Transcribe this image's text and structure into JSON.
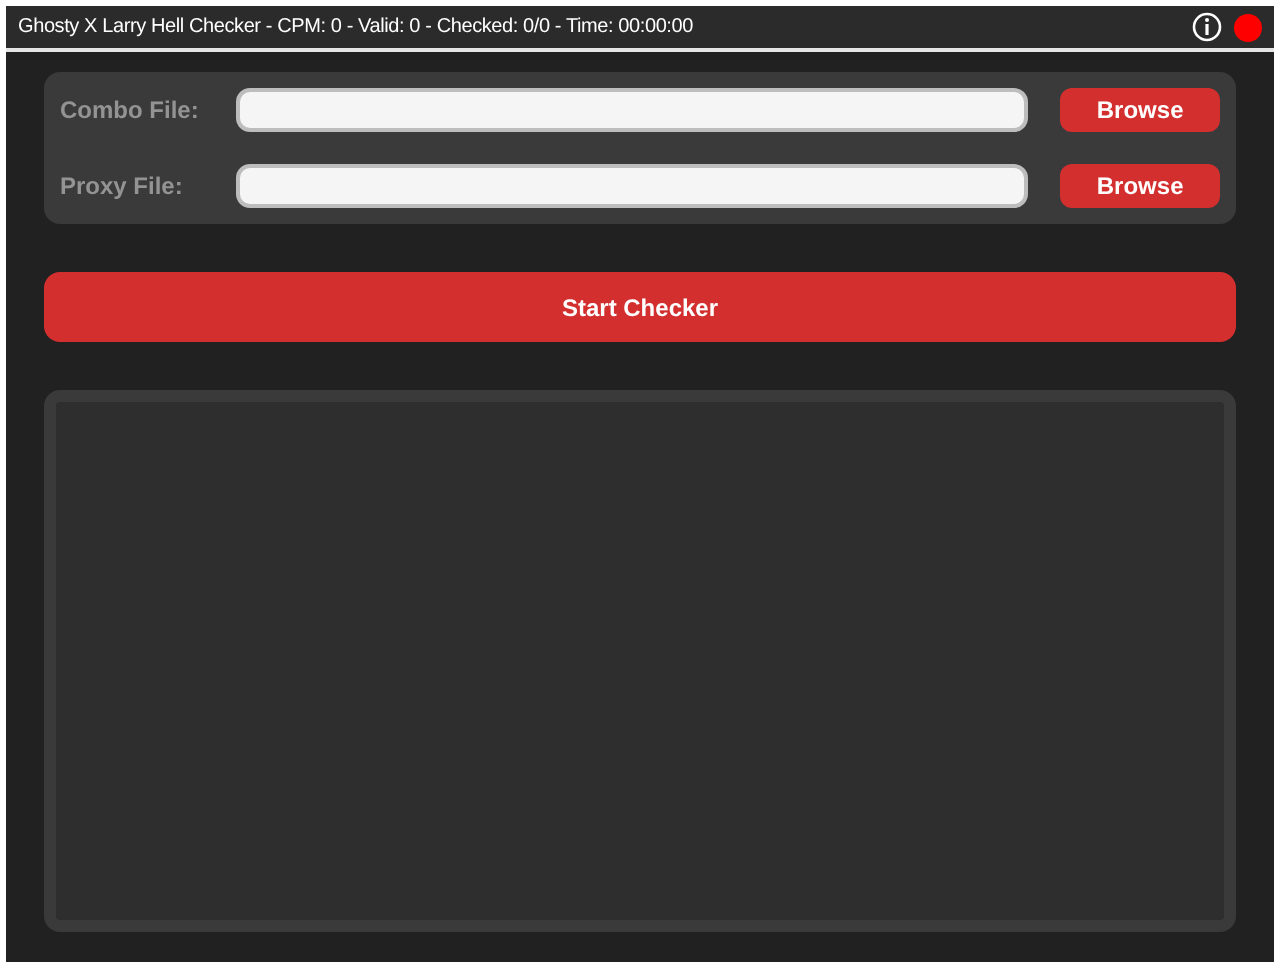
{
  "window": {
    "title": "Ghosty X Larry Hell Checker - CPM: 0 - Valid: 0 - Checked: 0/0 - Time: 00:00:00"
  },
  "files": [
    {
      "label": "Combo File:",
      "button": "Browse"
    },
    {
      "label": "Proxy File:",
      "button": "Browse"
    }
  ],
  "start_button": "Start Checker"
}
